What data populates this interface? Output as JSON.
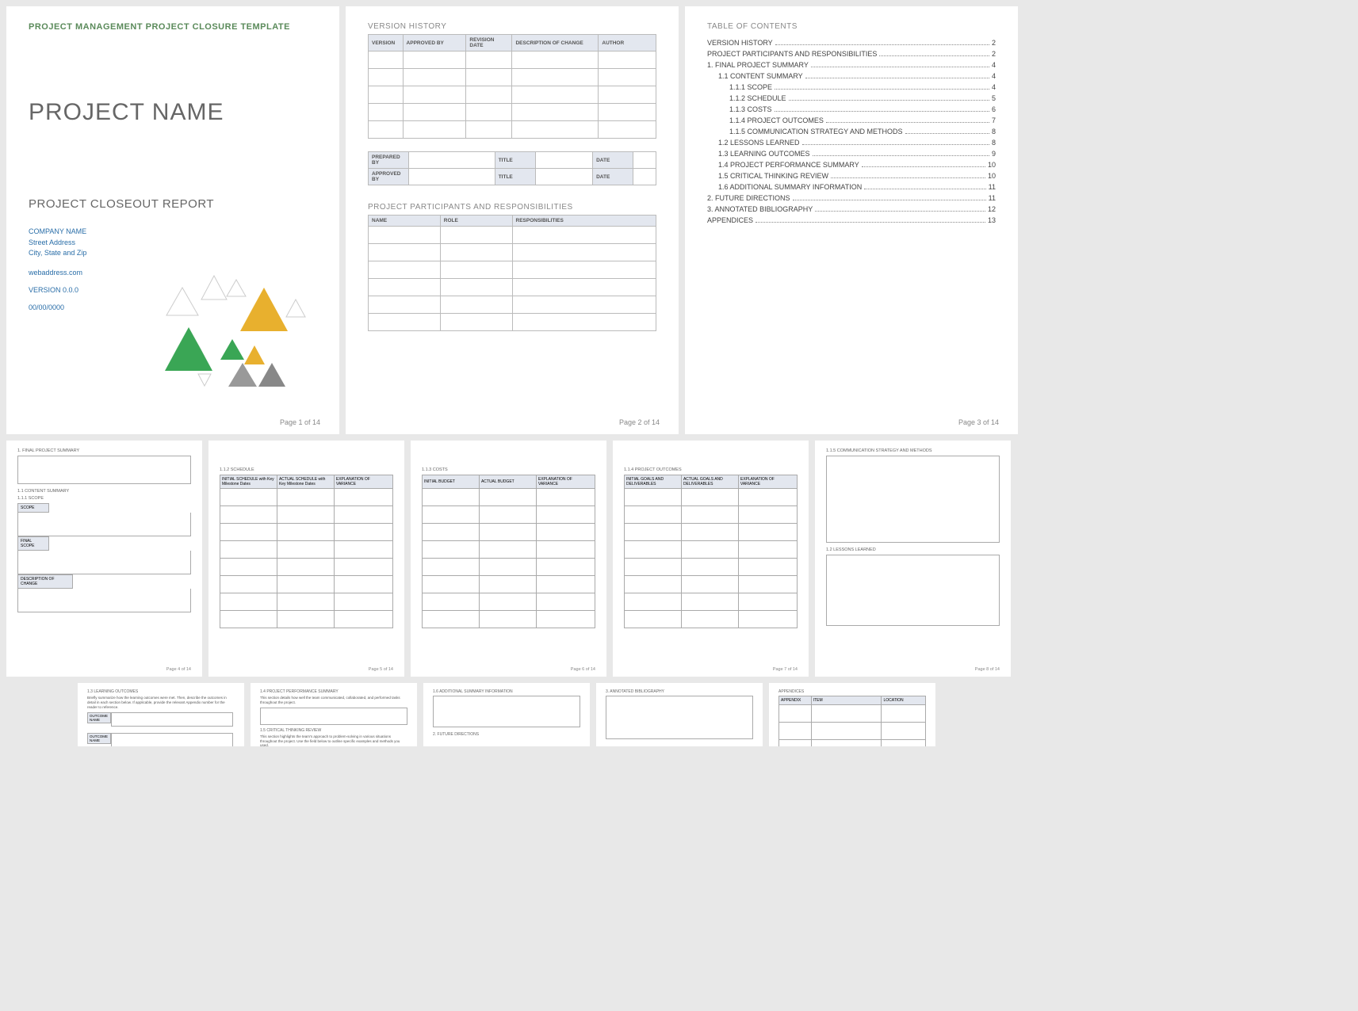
{
  "page1": {
    "header": "PROJECT MANAGEMENT PROJECT CLOSURE TEMPLATE",
    "title": "PROJECT NAME",
    "subtitle": "PROJECT CLOSEOUT REPORT",
    "company": "COMPANY NAME",
    "street": "Street Address",
    "city": "City, State and Zip",
    "web": "webaddress.com",
    "version": "VERSION 0.0.0",
    "date": "00/00/0000",
    "pgnum": "Page 1 of 14"
  },
  "page2": {
    "h1": "VERSION HISTORY",
    "vh_cols": [
      "VERSION",
      "APPROVED BY",
      "REVISION DATE",
      "DESCRIPTION OF CHANGE",
      "AUTHOR"
    ],
    "sig": {
      "prep": "PREPARED BY",
      "appr": "APPROVED BY",
      "title": "TITLE",
      "date": "DATE"
    },
    "h2": "PROJECT PARTICIPANTS AND RESPONSIBILITIES",
    "pp_cols": [
      "NAME",
      "ROLE",
      "RESPONSIBILITIES"
    ],
    "pgnum": "Page 2 of 14"
  },
  "page3": {
    "h": "TABLE OF CONTENTS",
    "items": [
      {
        "lvl": 0,
        "label": "VERSION HISTORY",
        "pg": "2"
      },
      {
        "lvl": 0,
        "label": "PROJECT PARTICIPANTS AND RESPONSIBILITIES",
        "pg": "2"
      },
      {
        "lvl": 0,
        "label": "1.  FINAL PROJECT SUMMARY",
        "pg": "4"
      },
      {
        "lvl": 1,
        "label": "1.1   CONTENT SUMMARY",
        "pg": "4"
      },
      {
        "lvl": 2,
        "label": "1.1.1  SCOPE",
        "pg": "4"
      },
      {
        "lvl": 2,
        "label": "1.1.2  SCHEDULE",
        "pg": "5"
      },
      {
        "lvl": 2,
        "label": "1.1.3  COSTS",
        "pg": "6"
      },
      {
        "lvl": 2,
        "label": "1.1.4  PROJECT OUTCOMES",
        "pg": "7"
      },
      {
        "lvl": 2,
        "label": "1.1.5  COMMUNICATION STRATEGY AND METHODS",
        "pg": "8"
      },
      {
        "lvl": 1,
        "label": "1.2   LESSONS LEARNED",
        "pg": "8"
      },
      {
        "lvl": 1,
        "label": "1.3   LEARNING OUTCOMES",
        "pg": "9"
      },
      {
        "lvl": 1,
        "label": "1.4   PROJECT PERFORMANCE SUMMARY",
        "pg": "10"
      },
      {
        "lvl": 1,
        "label": "1.5   CRITICAL THINKING REVIEW",
        "pg": "10"
      },
      {
        "lvl": 1,
        "label": "1.6   ADDITIONAL SUMMARY INFORMATION",
        "pg": "11"
      },
      {
        "lvl": 0,
        "label": "2.  FUTURE DIRECTIONS",
        "pg": "11"
      },
      {
        "lvl": 0,
        "label": "3.  ANNOTATED BIBLIOGRAPHY",
        "pg": "12"
      },
      {
        "lvl": 0,
        "label": "APPENDICES",
        "pg": "13"
      }
    ],
    "pgnum": "Page 3 of 14"
  },
  "page4": {
    "h1": "1.  FINAL PROJECT SUMMARY",
    "h2": "1.1   CONTENT SUMMARY",
    "h3": "1.1.1  SCOPE",
    "scope": "SCOPE",
    "final": "FINAL SCOPE",
    "change": "DESCRIPTION OF CHANGE",
    "pgnum": "Page 4 of 14"
  },
  "page5": {
    "h": "1.1.2  SCHEDULE",
    "cols": [
      "INITIAL SCHEDULE  with Key Milestone Dates",
      "ACTUAL SCHEDULE  with Key Milestone Dates",
      "EXPLANATION OF VARIANCE"
    ],
    "pgnum": "Page 5 of 14"
  },
  "page6": {
    "h": "1.1.3  COSTS",
    "cols": [
      "INITIAL BUDGET",
      "ACTUAL BUDGET",
      "EXPLANATION OF VARIANCE"
    ],
    "pgnum": "Page 6 of 14"
  },
  "page7": {
    "h": "1.1.4  PROJECT OUTCOMES",
    "cols": [
      "INITIAL GOALS AND DELIVERABLES",
      "ACTUAL GOALS AND DELIVERABLES",
      "EXPLANATION OF VARIANCE"
    ],
    "pgnum": "Page 7 of 14"
  },
  "page8": {
    "h1": "1.1.5  COMMUNICATION STRATEGY AND METHODS",
    "h2": "1.2   LESSONS LEARNED",
    "pgnum": "Page 8 of 14"
  },
  "page9": {
    "h": "1.3   LEARNING OUTCOMES",
    "desc": "Briefly summarize how the learning outcomes were met. Then, describe the outcomes in detail in each section below. If applicable, provide the relevant Appendix number for the reader to reference.",
    "label": "OUTCOME NAME"
  },
  "page10": {
    "h1": "1.4   PROJECT PERFORMANCE SUMMARY",
    "d1": "This section details how well the team communicated, collaborated, and performed tasks throughout the project.",
    "h2": "1.5   CRITICAL THINKING REVIEW",
    "d2": "This section highlights the team's approach to problem-solving in various situations throughout the project. Use the field below to outline specific examples and methods you used."
  },
  "page11": {
    "h1": "1.6   ADDITIONAL SUMMARY INFORMATION",
    "h2": "2.  FUTURE DIRECTIONS"
  },
  "page12": {
    "h": "3.  ANNOTATED BIBLIOGRAPHY"
  },
  "page13": {
    "h": "APPENDICES",
    "cols": [
      "APPENDIX",
      "ITEM",
      "LOCATION"
    ]
  }
}
